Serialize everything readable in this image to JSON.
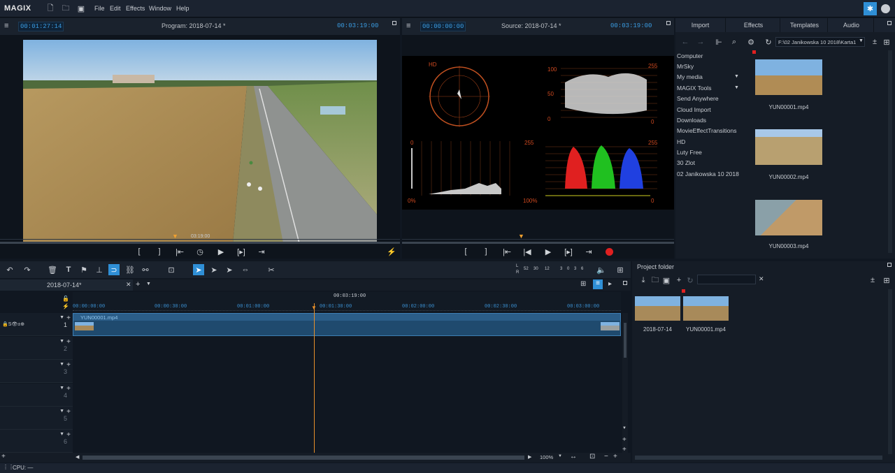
{
  "app": {
    "logo": "MAGIX"
  },
  "menu": [
    "File",
    "Edit",
    "Effects",
    "Window",
    "Help"
  ],
  "program": {
    "timecode": "00:01:27:14",
    "title": "Program: 2018-07-14 *",
    "duration": "00:03:19:00",
    "scrub_time": "03:19:00"
  },
  "source": {
    "timecode": "00:00:00:00",
    "title": "Source: 2018-07-14 *",
    "duration": "00:03:19:00"
  },
  "scopes": {
    "vector_labels": [
      "HD"
    ],
    "wave_top": [
      "100",
      "50",
      "0"
    ],
    "wave_right": [
      "255",
      "0"
    ],
    "hist_left": [
      "0",
      "0%"
    ],
    "hist_right": [
      "255",
      "100%"
    ],
    "rgb_right": [
      "255",
      "0"
    ]
  },
  "media": {
    "tabs": [
      "Import",
      "Effects",
      "Templates",
      "Audio"
    ],
    "path": "F:\\02 Janikowska 10 2018\\Karta1",
    "nav": [
      "Computer",
      "MrSky",
      "My media",
      "MAGIX Tools",
      "Send Anywhere",
      "Cloud Import",
      "Downloads",
      "MovieEffectTransitions",
      "HD",
      "Luty Free",
      "30 Zlot",
      "02 Janikowska 10 2018"
    ],
    "files": [
      "YUN00001.mp4",
      "YUN00002.mp4",
      "YUN00003.mp4"
    ]
  },
  "timeline": {
    "tab": "2018-07-14*",
    "playhead": "00:03:19:00",
    "ruler": [
      "00:00:00:00",
      "00:00:30:00",
      "00:01:00:00",
      "00:01:30:00",
      "00:02:00:00",
      "00:02:30:00",
      "00:03:00:00"
    ],
    "clip": "YUN00001.mp4",
    "tracks": [
      "1",
      "2",
      "3",
      "4",
      "5",
      "6"
    ],
    "meter": {
      "L": "L",
      "R": "R",
      "scale": [
        "52",
        "30",
        "12",
        "3",
        "0",
        "3",
        "6"
      ]
    },
    "zoom": "100%"
  },
  "projfolder": {
    "title": "Project folder",
    "items": [
      "2018-07-14",
      "YUN00001.mp4"
    ]
  },
  "status": {
    "cpu": "CPU: —"
  }
}
